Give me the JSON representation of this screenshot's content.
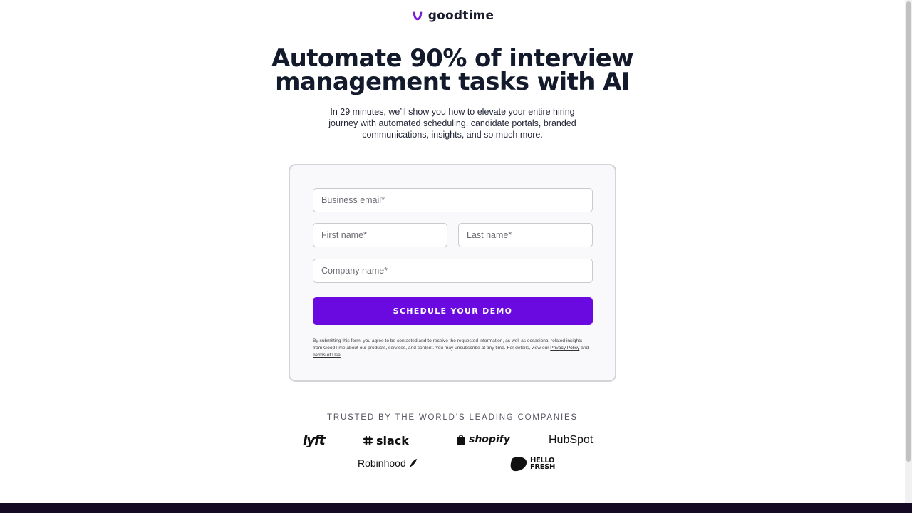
{
  "brand": {
    "name": "goodtime",
    "accent": "#6b0ae0",
    "logo_color": "#7b1fd6"
  },
  "hero": {
    "title_line1": "Automate 90% of interview",
    "title_line2": "management tasks with AI",
    "subtitle": "In 29 minutes, we’ll show you how to elevate your entire hiring journey with automated scheduling, candidate portals, branded communications, insights, and so much more."
  },
  "form": {
    "email_placeholder": "Business email*",
    "first_name_placeholder": "First name*",
    "last_name_placeholder": "Last name*",
    "company_placeholder": "Company name*",
    "submit_label": "SCHEDULE YOUR DEMO",
    "consent_text": "By submitting this form, you agree to be contacted and to receive the requested information, as well as occasional related insights from GoodTime about our products, services, and content. You may unsubscribe at any time. For details, view our",
    "privacy_link": "Privacy Policy",
    "and_text": "and",
    "terms_link": "Terms of Use",
    "period": "."
  },
  "trusted": {
    "heading": "TRUSTED BY THE WORLD’S LEADING COMPANIES",
    "logos": {
      "lyft": "lyft",
      "slack": "slack",
      "shopify": "shopify",
      "hubspot": "HubSpot",
      "robinhood": "Robinhood",
      "hellofresh_line1": "HELLO",
      "hellofresh_line2": "FRESH"
    }
  }
}
